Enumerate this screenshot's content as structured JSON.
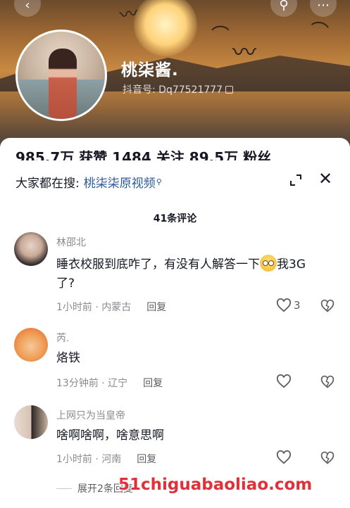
{
  "profile": {
    "name": "桃柒酱.",
    "id_label": "抖音号: Dq77521777",
    "stats_line": "985.7万 获赞  1484 关注  89.5万 粉丝"
  },
  "search_bar": {
    "prefix": "大家都在搜:",
    "query": "桃柒柒原视频",
    "search_glyph": "⚲"
  },
  "comment_count": "41条评论",
  "comments": [
    {
      "username": "林邵北",
      "text_before_emoji": "睡衣校服到底咋了，有没有人解答一下",
      "text_after_emoji": "我3G了?",
      "meta": "1小时前 · 内蒙古",
      "reply_label": "回复",
      "likes": "3"
    },
    {
      "username": "芮.",
      "text": "烙铁",
      "meta": "13分钟前 · 辽宁",
      "reply_label": "回复",
      "likes": ""
    },
    {
      "username": "上网只为当皇帝",
      "text": "啥啊啥啊，啥意思啊",
      "meta": "1小时前 · 河南",
      "reply_label": "回复",
      "likes": ""
    }
  ],
  "expand_replies": "展开2条回复",
  "watermark": "51chiguabaoliao.com",
  "colors": {
    "link": "#2b5a9c",
    "secondary_text": "#8a8b91",
    "watermark": "#e0303a"
  },
  "icons": [
    "back-icon",
    "search-icon",
    "more-icon",
    "copy-icon",
    "expand-icon",
    "close-icon",
    "heart-icon",
    "dislike-heart-icon"
  ]
}
